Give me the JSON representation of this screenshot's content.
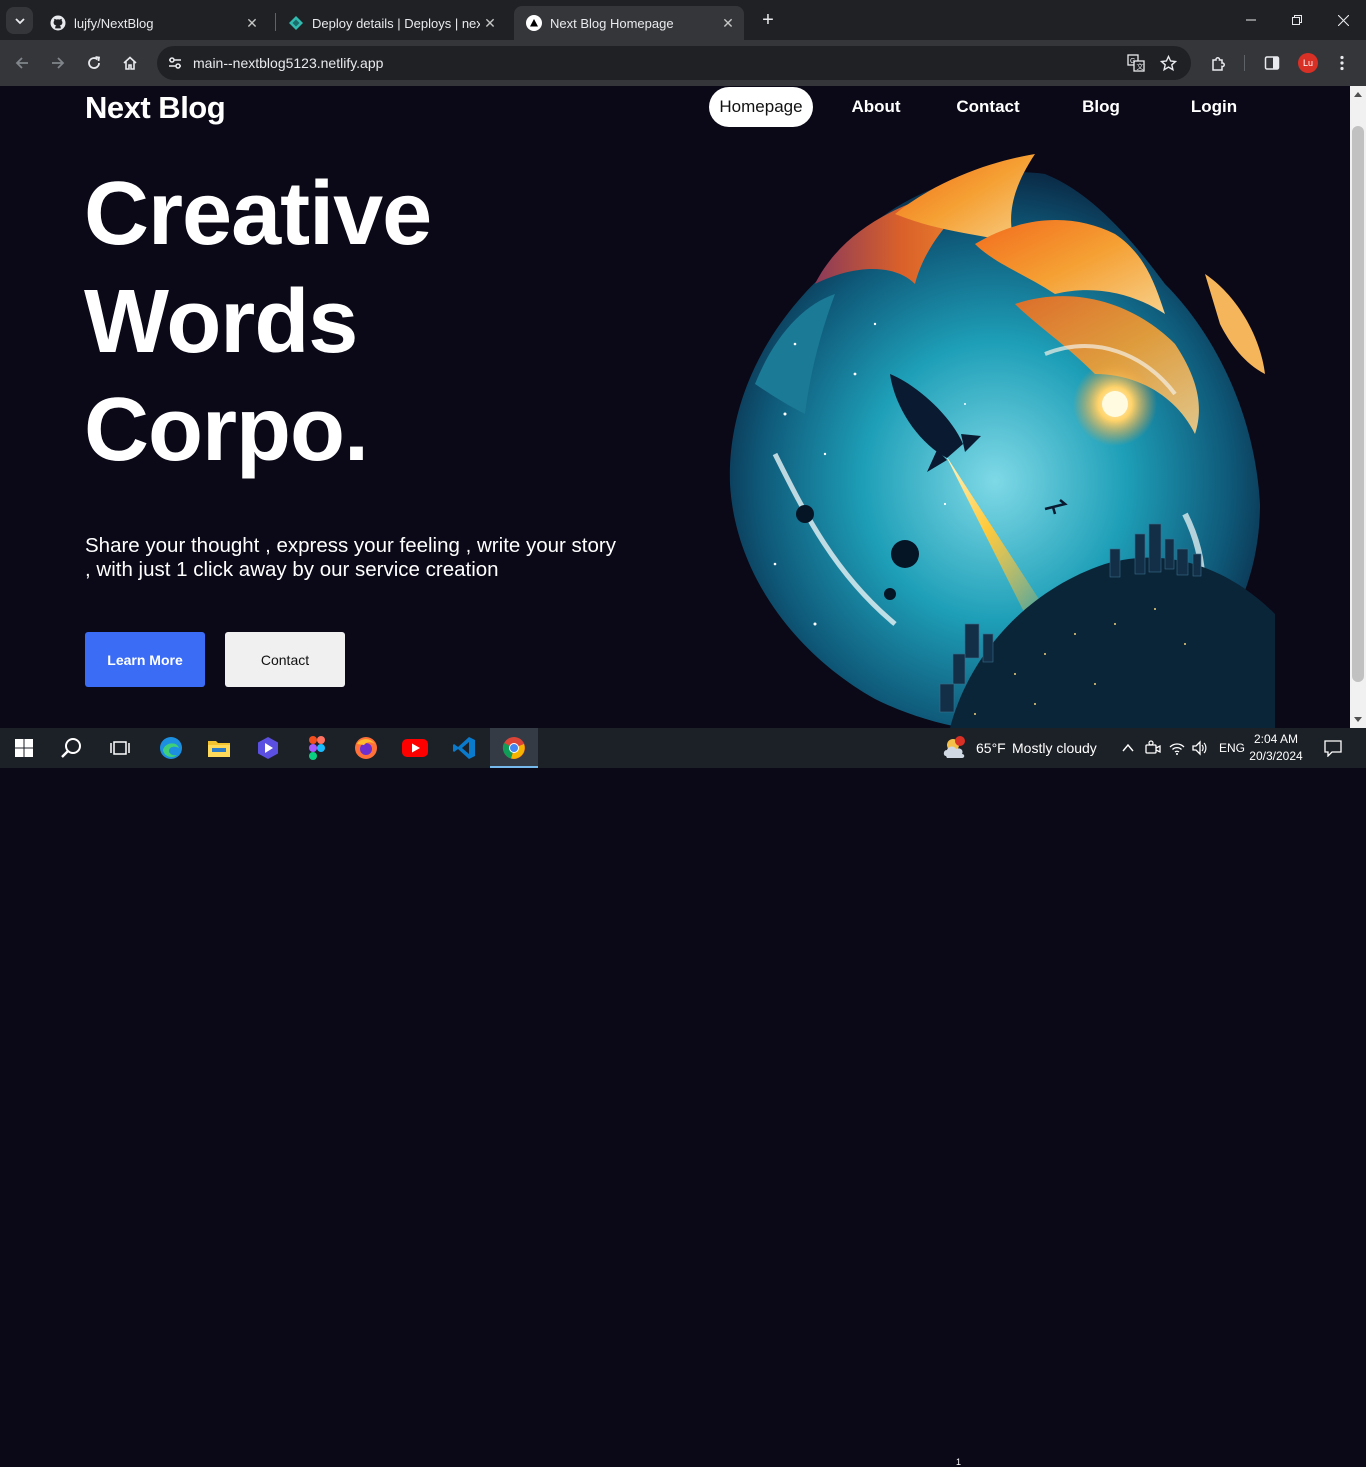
{
  "browser": {
    "tabs": [
      {
        "title": "lujfy/NextBlog",
        "icon": "github-icon",
        "active": false
      },
      {
        "title": "Deploy details | Deploys | nextb",
        "icon": "netlify-icon",
        "active": false
      },
      {
        "title": "Next Blog Homepage",
        "icon": "triangle-icon",
        "active": true
      }
    ],
    "url": "main--nextblog5123.netlify.app",
    "profile_initials": "Lu"
  },
  "site": {
    "logo": "Next Blog",
    "nav": {
      "homepage": "Homepage",
      "about": "About",
      "contact": "Contact",
      "blog": "Blog",
      "login": "Login"
    },
    "hero": {
      "line1": "Creative",
      "line2": "Words",
      "line3": "Corpo."
    },
    "tagline": "Share your thought , express your feeling , write your story , with just 1 click away by our service creation",
    "buttons": {
      "learn_more": "Learn More",
      "contact": "Contact"
    },
    "colors": {
      "background": "#0b0817",
      "primary_button": "#3b6cf6",
      "secondary_button": "#f0f0f0"
    }
  },
  "taskbar": {
    "weather_temp": "65°F",
    "weather_desc": "Mostly cloudy",
    "weather_badge": "1",
    "language": "ENG",
    "time": "2:04 AM",
    "date": "20/3/2024"
  }
}
